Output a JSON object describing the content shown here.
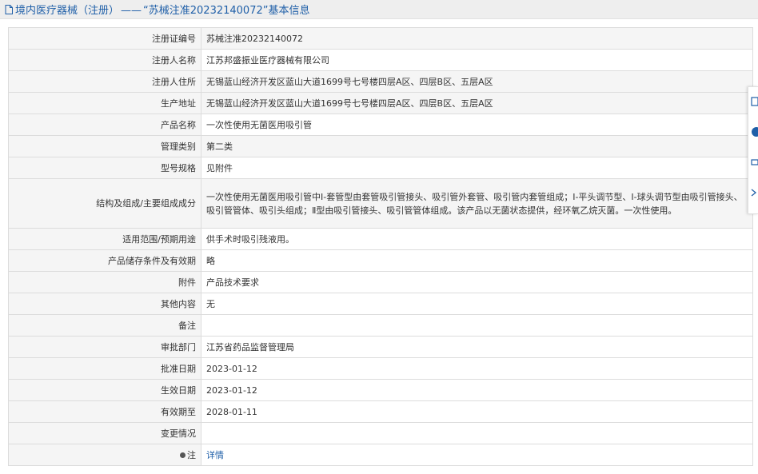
{
  "header": {
    "category": "境内医疗器械（注册）",
    "dash": "——",
    "record": "“苏械注准20232140072”基本信息"
  },
  "rows": [
    {
      "label": "注册证编号",
      "value": "苏械注准20232140072"
    },
    {
      "label": "注册人名称",
      "value": "江苏邦盛振业医疗器械有限公司"
    },
    {
      "label": "注册人住所",
      "value": "无锡蓝山经济开发区蓝山大道1699号七号楼四层A区、四层B区、五层A区"
    },
    {
      "label": "生产地址",
      "value": "无锡蓝山经济开发区蓝山大道1699号七号楼四层A区、四层B区、五层A区"
    },
    {
      "label": "产品名称",
      "value": "一次性使用无菌医用吸引管"
    },
    {
      "label": "管理类别",
      "value": "第二类"
    },
    {
      "label": "型号规格",
      "value": "见附件"
    },
    {
      "label": "结构及组成/主要组成成分",
      "value": "一次性使用无菌医用吸引管中Ⅰ-套管型由套管吸引管接头、吸引管外套管、吸引管内套管组成；Ⅰ-平头调节型、Ⅰ-球头调节型由吸引管接头、吸引管管体、吸引头组成；Ⅱ型由吸引管接头、吸引管管体组成。该产品以无菌状态提供，经环氧乙烷灭菌。一次性使用。"
    },
    {
      "label": "适用范围/预期用途",
      "value": "供手术时吸引残液用。"
    },
    {
      "label": "产品储存条件及有效期",
      "value": "略"
    },
    {
      "label": "附件",
      "value": "产品技术要求"
    },
    {
      "label": "其他内容",
      "value": "无"
    },
    {
      "label": "备注",
      "value": ""
    },
    {
      "label": "审批部门",
      "value": "江苏省药品监督管理局"
    },
    {
      "label": "批准日期",
      "value": "2023-01-12"
    },
    {
      "label": "生效日期",
      "value": "2023-01-12"
    },
    {
      "label": "有效期至",
      "value": "2028-01-11"
    },
    {
      "label": "变更情况",
      "value": ""
    }
  ],
  "note_row": {
    "label": "注",
    "link": "详情"
  },
  "colors": {
    "link": "#1f5fa8",
    "label_bg": "#f5f5f5",
    "border": "#dcdcdc",
    "header_bg": "#eeeeee"
  }
}
